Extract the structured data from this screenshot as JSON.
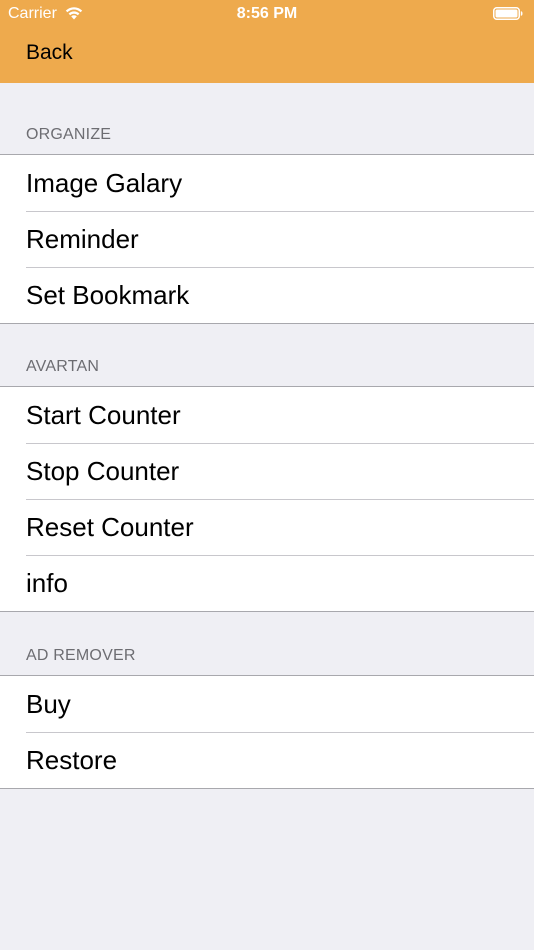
{
  "status_bar": {
    "carrier": "Carrier",
    "time": "8:56 PM"
  },
  "nav": {
    "back_label": "Back"
  },
  "sections": [
    {
      "header": "ORGANIZE",
      "items": [
        "Image Galary",
        "Reminder",
        "Set Bookmark"
      ]
    },
    {
      "header": "AVARTAN",
      "items": [
        "Start Counter",
        "Stop Counter",
        "Reset Counter",
        "info"
      ]
    },
    {
      "header": "AD REMOVER",
      "items": [
        "Buy",
        "Restore"
      ]
    }
  ],
  "colors": {
    "nav_bar": "#eeaa4d",
    "background": "#efeff4",
    "section_header_text": "#6d6d72"
  },
  "icons": {
    "wifi": "wifi-icon",
    "battery": "battery-icon"
  }
}
